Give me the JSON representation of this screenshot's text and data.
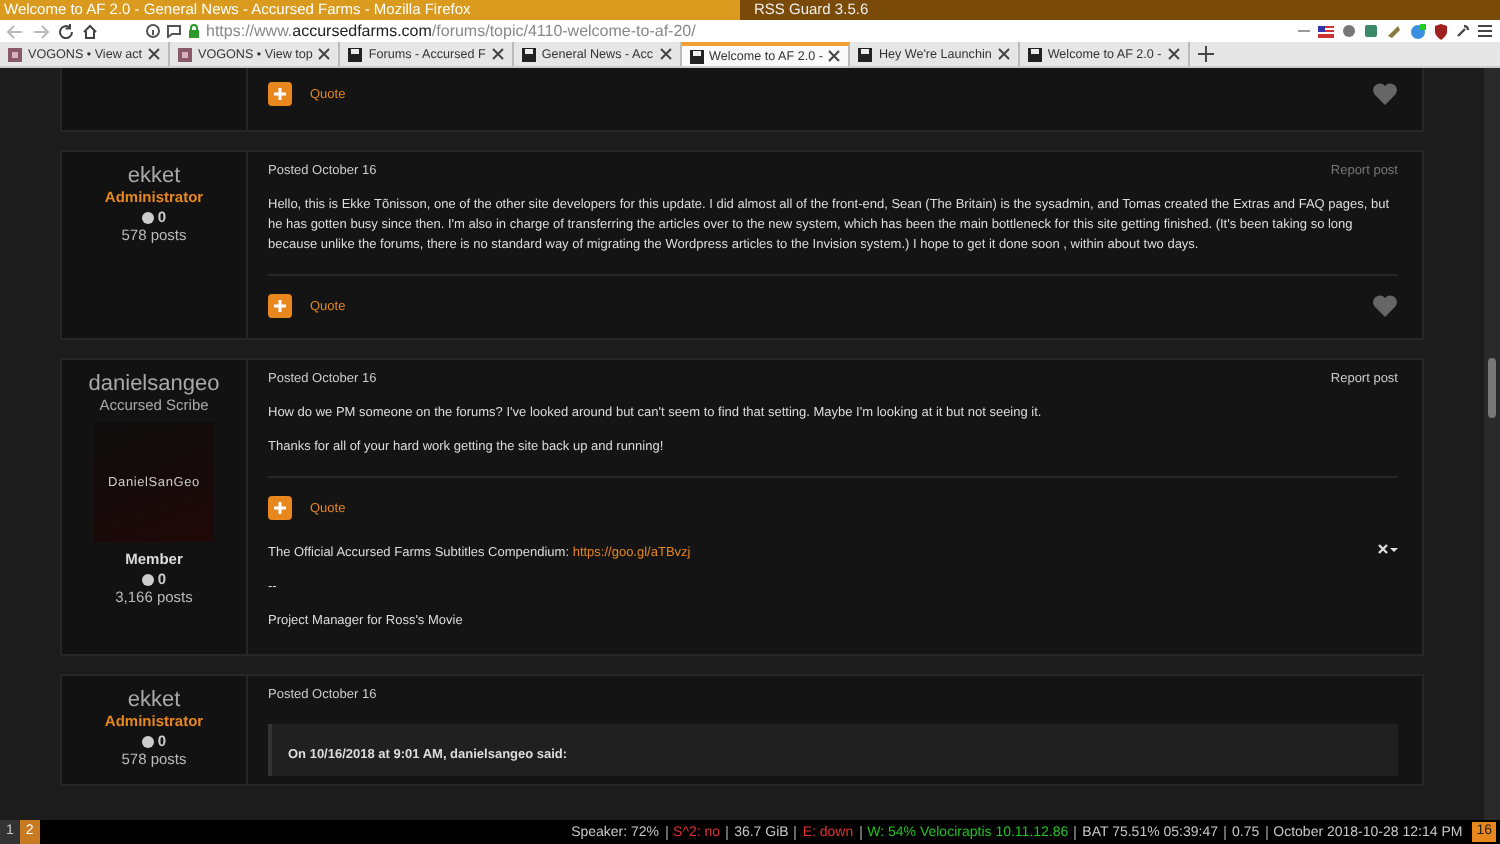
{
  "window": {
    "title": "Welcome to AF 2.0 - General News - Accursed Farms - Mozilla Firefox",
    "second_title": "RSS Guard 3.5.6"
  },
  "address_bar": {
    "url_prefix": "https://www.",
    "url_domain": "accursedfarms.com",
    "url_path": "/forums/topic/4110-welcome-to-af-20/"
  },
  "tabs": [
    {
      "label": "VOGONS • View act",
      "selected": false,
      "kind": "vogons"
    },
    {
      "label": "VOGONS • View top",
      "selected": false,
      "kind": "vogons"
    },
    {
      "label": "Forums - Accursed F",
      "selected": false,
      "kind": "af"
    },
    {
      "label": "General News - Acc",
      "selected": false,
      "kind": "af"
    },
    {
      "label": "Welcome to AF 2.0 -",
      "selected": true,
      "kind": "af"
    },
    {
      "label": "Hey We're Launchin",
      "selected": false,
      "kind": "af"
    },
    {
      "label": "Welcome to AF 2.0 -",
      "selected": false,
      "kind": "af"
    }
  ],
  "posts": [
    {
      "quote_label": "Quote",
      "like_button": true
    },
    {
      "author": "ekket",
      "role": {
        "label": "Administrator",
        "kind": "staff"
      },
      "reputation": "0",
      "post_count": "578 posts",
      "date": "Posted October 16",
      "report": "Report post",
      "report_dim": true,
      "paragraphs": [
        "Hello, this is Ekke Tõnisson, one of the other site developers for this update. I did almost all of the front-end, Sean (The Britain) is the sysadmin, and Tomas created the Extras and FAQ pages, but he has gotten busy since then. I'm also in charge of transferring the articles over to the new system, which has been the main bottleneck for this site getting finished. (It's been taking so long because unlike the forums, there is no standard way of migrating the Wordpress articles to the Invision system.) I hope to get it done soon  , within about two days."
      ],
      "quote_label": "Quote",
      "like_button": true
    },
    {
      "author": "danielsangeo",
      "role": {
        "label": "Accursed Scribe",
        "kind": "member"
      },
      "avatar_text": "DanielSanGeo",
      "rank": "Member",
      "reputation": "0",
      "post_count": "3,166 posts",
      "date": "Posted October 16",
      "report": "Report post",
      "report_dim": false,
      "paragraphs": [
        "How do we PM someone on the forums?  I've looked around but can't seem to find that setting.  Maybe I'm looking at it but not seeing it.",
        "Thanks for all of your hard work getting the site back up and running!"
      ],
      "quote_label": "Quote",
      "like_button": false,
      "signature": {
        "lead": "The Official Accursed Farms Subtitles Compendium: ",
        "link": "https://goo.gl/aTBvzj",
        "lines": [
          "--",
          "Project Manager for Ross's Movie"
        ]
      }
    },
    {
      "author": "ekket",
      "role": {
        "label": "Administrator",
        "kind": "staff"
      },
      "reputation": "0",
      "post_count": "578 posts",
      "date": "Posted October 16",
      "quote_header": "On 10/16/2018 at 9:01 AM, danielsangeo said:"
    }
  ],
  "status_bar": {
    "workspaces": [
      {
        "label": "1",
        "selected": false
      },
      {
        "label": "2",
        "selected": true
      }
    ],
    "items": [
      {
        "text": "Speaker: 72%",
        "color": "#c8c8c8"
      },
      {
        "text": "S^2: no",
        "color": "#e03030"
      },
      {
        "text": "36.7 GiB",
        "color": "#c8c8c8"
      },
      {
        "text": "E: down",
        "color": "#e03030"
      },
      {
        "text": "W:  54% Velociraptis 10.11.12.86",
        "color": "#22c022"
      },
      {
        "text": "BAT 75.51% 05:39:47",
        "color": "#c8c8c8"
      },
      {
        "text": "0.75",
        "color": "#c8c8c8"
      },
      {
        "text": "October 2018-10-28 12:14 PM",
        "color": "#c8c8c8"
      }
    ],
    "tray": "16"
  }
}
